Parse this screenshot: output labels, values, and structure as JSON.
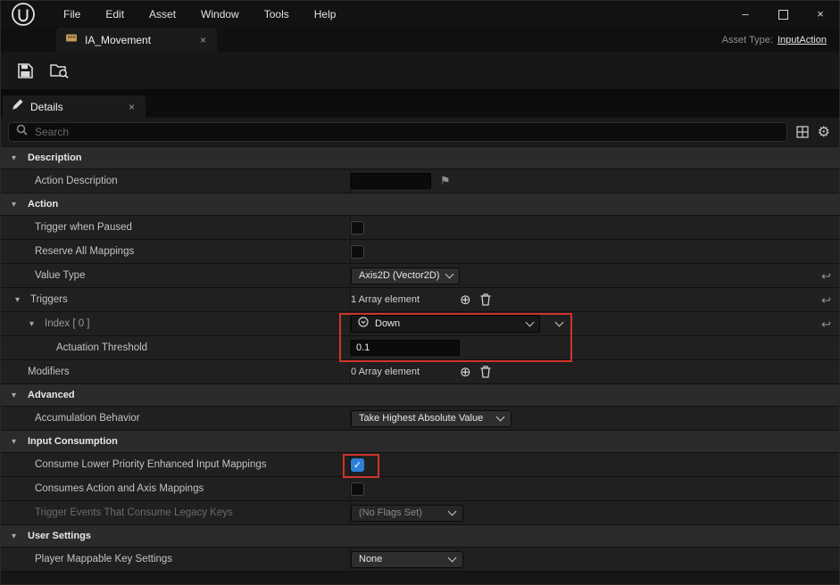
{
  "colors": {
    "accent_blue": "#2e7fd6",
    "highlight_red": "#d0342c"
  },
  "titlebar": {
    "menu_items": [
      "File",
      "Edit",
      "Asset",
      "Window",
      "Tools",
      "Help"
    ],
    "minimize_glyph": "–",
    "close_glyph": "×"
  },
  "asset_tab": {
    "label": "IA_Movement",
    "close_glyph": "×"
  },
  "asset_type": {
    "label": "Asset Type:",
    "value": "InputAction"
  },
  "panel_tab": {
    "label": "Details",
    "close_glyph": "×"
  },
  "search": {
    "placeholder": "Search",
    "gear_glyph": "⚙"
  },
  "icons": {
    "check": "✓",
    "add": "⊕",
    "reset": "↩",
    "flag": "⚑",
    "tri_down": "▾"
  },
  "details": {
    "description": {
      "header": "Description",
      "action_description": {
        "label": "Action Description",
        "value": ""
      }
    },
    "action": {
      "header": "Action",
      "trigger_when_paused": {
        "label": "Trigger when Paused",
        "checked": false
      },
      "reserve_all_mappings": {
        "label": "Reserve All Mappings",
        "checked": false
      },
      "value_type": {
        "label": "Value Type",
        "value": "Axis2D (Vector2D)"
      },
      "triggers": {
        "label": "Triggers",
        "summary": "1 Array element"
      },
      "index_0": {
        "label": "Index [ 0 ]",
        "value": "Down"
      },
      "actuation_threshold": {
        "label": "Actuation Threshold",
        "value": "0.1"
      },
      "modifiers": {
        "label": "Modifiers",
        "summary": "0 Array element"
      }
    },
    "advanced": {
      "header": "Advanced",
      "accumulation_behavior": {
        "label": "Accumulation Behavior",
        "value": "Take Highest Absolute Value"
      }
    },
    "input_consumption": {
      "header": "Input Consumption",
      "consume_lower_priority": {
        "label": "Consume Lower Priority Enhanced Input Mappings",
        "checked": true
      },
      "consumes_action_axis": {
        "label": "Consumes Action and Axis Mappings",
        "checked": false
      },
      "trigger_events_legacy": {
        "label": "Trigger Events That Consume Legacy Keys",
        "value": "(No Flags Set)"
      }
    },
    "user_settings": {
      "header": "User Settings",
      "player_mappable_key_settings": {
        "label": "Player Mappable Key Settings",
        "value": "None"
      }
    }
  }
}
